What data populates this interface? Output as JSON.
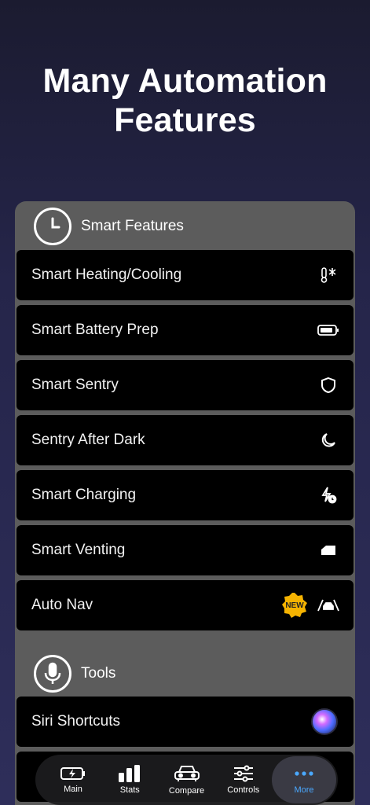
{
  "hero": {
    "line1": "Many Automation",
    "line2": "Features"
  },
  "sections": {
    "smart": {
      "title": "Smart Features",
      "icon": "clock-icon"
    },
    "tools": {
      "title": "Tools",
      "icon": "microphone-icon"
    }
  },
  "rows": {
    "heating": {
      "label": "Smart Heating/Cooling",
      "icon": "thermometer-snowflake-icon"
    },
    "battery": {
      "label": "Smart Battery Prep",
      "icon": "battery-icon"
    },
    "sentry": {
      "label": "Smart Sentry",
      "icon": "shield-icon"
    },
    "after_dark": {
      "label": "Sentry After Dark",
      "icon": "moon-icon"
    },
    "charging": {
      "label": "Smart Charging",
      "icon": "bolt-clock-icon"
    },
    "venting": {
      "label": "Smart Venting",
      "icon": "window-icon"
    },
    "auto_nav": {
      "label": "Auto Nav",
      "badge": "NEW",
      "icon": "road-car-icon"
    },
    "siri": {
      "label": "Siri Shortcuts",
      "icon": "siri-icon"
    }
  },
  "tabs": [
    {
      "label": "Main",
      "icon": "battery-charging-icon"
    },
    {
      "label": "Stats",
      "icon": "bar-chart-icon"
    },
    {
      "label": "Compare",
      "icon": "cars-icon"
    },
    {
      "label": "Controls",
      "icon": "sliders-icon"
    },
    {
      "label": "More",
      "icon": "ellipsis-icon"
    }
  ],
  "colors": {
    "accent": "#4aa8ff",
    "badge": "#f5b301",
    "panel": "#5c5c5c",
    "row": "#000000"
  }
}
